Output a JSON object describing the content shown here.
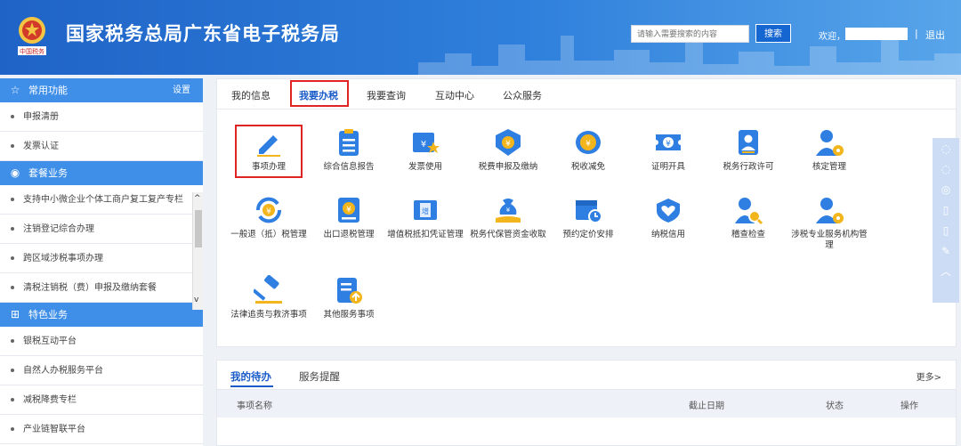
{
  "header": {
    "title": "国家税务总局广东省电子税务局",
    "emblem_text": "中国税务",
    "search_placeholder": "请输入需要搜索的内容",
    "search_label": "搜索",
    "welcome": "欢迎，",
    "separator": "|",
    "logout": "退出"
  },
  "sidebar": {
    "common": {
      "title": "常用功能",
      "settings": "设置",
      "items": [
        "申报清册",
        "发票认证"
      ]
    },
    "package": {
      "title": "套餐业务",
      "items": [
        "支持中小微企业个体工商户复工复产专栏",
        "注销登记综合办理",
        "跨区域涉税事项办理",
        "清税注销税（费）申报及缴纳套餐"
      ]
    },
    "special": {
      "title": "特色业务",
      "items": [
        "银税互动平台",
        "自然人办税服务平台",
        "减税降费专栏",
        "产业链智联平台"
      ]
    }
  },
  "main": {
    "tabs": [
      "我的信息",
      "我要办税",
      "我要查询",
      "互动中心",
      "公众服务"
    ],
    "services": [
      {
        "label": "事项办理",
        "icon": "pencil-icon"
      },
      {
        "label": "综合信息报告",
        "icon": "clipboard-icon"
      },
      {
        "label": "发票使用",
        "icon": "invoice-star-icon"
      },
      {
        "label": "税费申报及缴纳",
        "icon": "yuan-shield-icon"
      },
      {
        "label": "税收减免",
        "icon": "coin-stack-icon"
      },
      {
        "label": "证明开具",
        "icon": "ticket-yuan-icon"
      },
      {
        "label": "税务行政许可",
        "icon": "id-badge-icon"
      },
      {
        "label": "核定管理",
        "icon": "person-gear-icon"
      },
      {
        "label": "一般退（抵）税管理",
        "icon": "yuan-refresh-icon"
      },
      {
        "label": "出口退税管理",
        "icon": "yuan-doc-icon"
      },
      {
        "label": "增值税抵扣凭证管理",
        "icon": "vat-receipt-icon"
      },
      {
        "label": "税务代保管资金收取",
        "icon": "money-bag-hand-icon"
      },
      {
        "label": "预约定价安排",
        "icon": "calendar-clock-icon"
      },
      {
        "label": "纳税信用",
        "icon": "heart-shield-icon"
      },
      {
        "label": "稽查检查",
        "icon": "person-search-icon"
      },
      {
        "label": "涉税专业服务机构管理",
        "icon": "person-gear-2-icon"
      },
      {
        "label": "法律追责与救济事项",
        "icon": "gavel-icon"
      },
      {
        "label": "其他服务事项",
        "icon": "doc-upload-icon"
      }
    ]
  },
  "todo": {
    "tabs": [
      "我的待办",
      "服务提醒"
    ],
    "more": "更多>",
    "columns": [
      "事项名称",
      "截止日期",
      "状态",
      "操作"
    ]
  },
  "floatbar": {
    "icons": [
      "chat-icon",
      "chat-icon-2",
      "weibo-icon",
      "mobile-icon",
      "mobile-icon-2",
      "edit-icon",
      "back-to-top-icon"
    ]
  },
  "colors": {
    "header_blue": "#2f80dc",
    "accent_blue": "#3f8fe8",
    "icon_blue": "#2f7fe2",
    "icon_gold": "#f3b51c",
    "highlight_red": "#e02424"
  }
}
